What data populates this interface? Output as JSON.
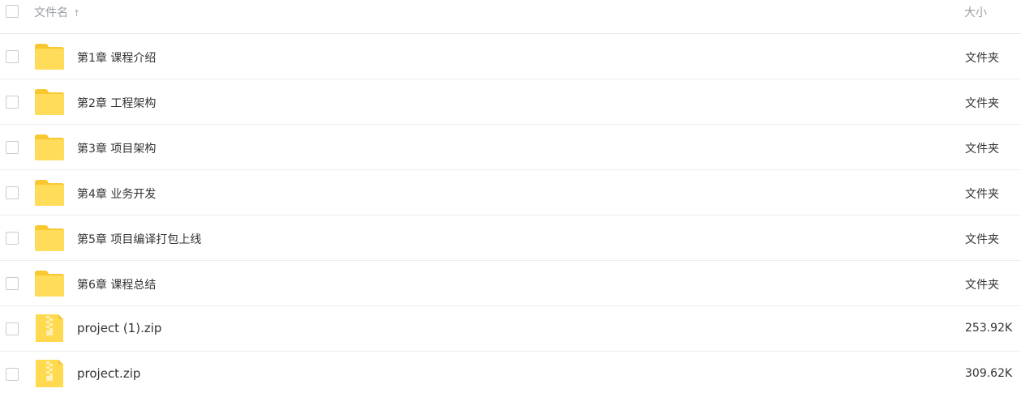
{
  "header": {
    "name_label": "文件名",
    "sort_icon": "↑",
    "size_label": "大小"
  },
  "colors": {
    "folder": "#FFD84D",
    "folder_tab": "#F8C82E",
    "zip": "#FFD84D",
    "zip_zipper": "#F5D45C",
    "divider": "#EDEEF1",
    "checkbox_border": "#C8CBD0"
  },
  "files": [
    {
      "name": "第1章 课程介绍",
      "size": "文件夹",
      "type": "folder",
      "icon": "folder-icon"
    },
    {
      "name": "第2章 工程架构",
      "size": "文件夹",
      "type": "folder",
      "icon": "folder-icon"
    },
    {
      "name": "第3章 项目架构",
      "size": "文件夹",
      "type": "folder",
      "icon": "folder-icon"
    },
    {
      "name": "第4章 业务开发",
      "size": "文件夹",
      "type": "folder",
      "icon": "folder-icon"
    },
    {
      "name": "第5章 项目编译打包上线",
      "size": "文件夹",
      "type": "folder",
      "icon": "folder-icon"
    },
    {
      "name": "第6章 课程总结",
      "size": "文件夹",
      "type": "folder",
      "icon": "folder-icon"
    },
    {
      "name": "project (1).zip",
      "size": "253.92K",
      "type": "zip",
      "icon": "zip-file-icon"
    },
    {
      "name": "project.zip",
      "size": "309.62K",
      "type": "zip",
      "icon": "zip-file-icon"
    }
  ]
}
